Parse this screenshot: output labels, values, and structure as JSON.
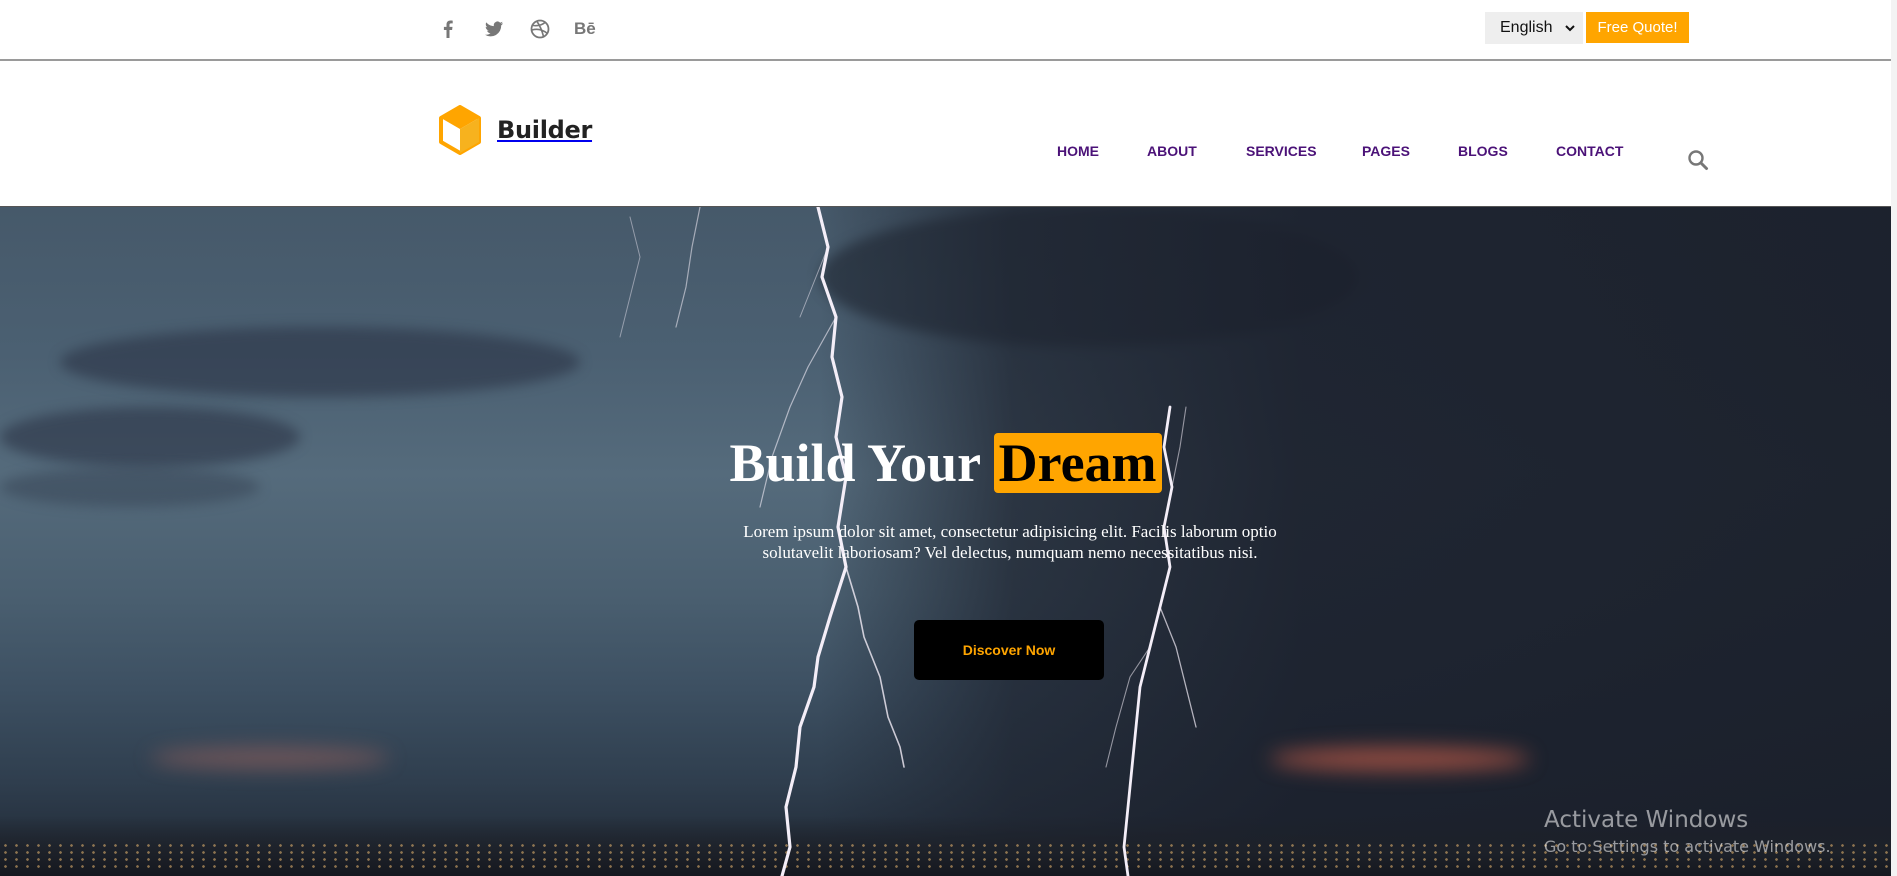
{
  "topbar": {
    "social": [
      {
        "name": "facebook-icon"
      },
      {
        "name": "twitter-icon"
      },
      {
        "name": "dribbble-icon"
      },
      {
        "name": "behance-icon",
        "text": "Bē"
      }
    ],
    "language": "English",
    "quote_button": "Free Quote!"
  },
  "header": {
    "logo_text": "Builder",
    "nav": [
      "HOME",
      "ABOUT",
      "SERVICES",
      "PAGES",
      "BLOGS",
      "CONTACT"
    ],
    "search_icon": "search-icon"
  },
  "hero": {
    "title_plain": "Build Your ",
    "title_highlight": "Dream",
    "text": "Lorem ipsum dolor sit amet, consectetur adipisicing elit. Facilis laborum optio solutavelit laboriosam? Vel delectus, numquam nemo necessitatibus nisi.",
    "button": "Discover Now"
  },
  "os_watermark": {
    "line1": "Activate Windows",
    "line2": "Go to Settings to activate Windows."
  },
  "colors": {
    "accent": "#ffa500",
    "nav": "#4b1278",
    "social": "#777777"
  }
}
